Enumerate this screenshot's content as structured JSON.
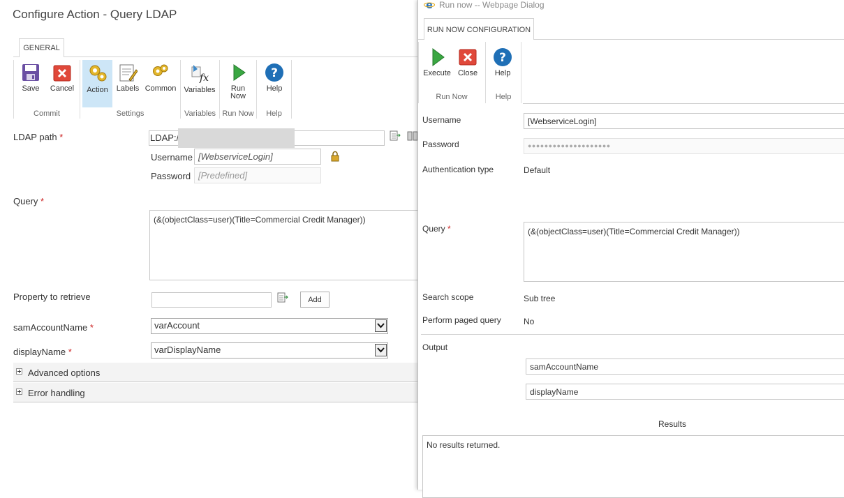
{
  "left": {
    "title": "Configure Action - Query LDAP",
    "tab": "GENERAL",
    "ribbon": {
      "save": "Save",
      "cancel": "Cancel",
      "action": "Action",
      "labels": "Labels",
      "common": "Common",
      "variables": "Variables",
      "run_now": "Run Now",
      "help": "Help",
      "groups": {
        "commit": "Commit",
        "settings": "Settings",
        "variables": "Variables",
        "run_now": "Run Now",
        "help": "Help"
      }
    },
    "ldap_path": {
      "label": "LDAP path",
      "value": "LDAP://"
    },
    "username": {
      "label": "Username",
      "value": "[WebserviceLogin]"
    },
    "password": {
      "label": "Password",
      "value": "[Predefined]"
    },
    "query": {
      "label": "Query",
      "value": "(&(objectClass=user)(Title=Commercial Credit Manager))"
    },
    "property": {
      "label": "Property to retrieve",
      "value": "",
      "add": "Add"
    },
    "sam": {
      "label": "samAccountName",
      "value": "varAccount"
    },
    "display": {
      "label": "displayName",
      "value": "varDisplayName"
    },
    "required_mark": "*",
    "advanced": "Advanced options",
    "error": "Error handling"
  },
  "dialog": {
    "title": "Run now -- Webpage Dialog",
    "tab": "RUN NOW CONFIGURATION",
    "ribbon": {
      "execute": "Execute",
      "close": "Close",
      "help": "Help",
      "groups": {
        "run_now": "Run Now",
        "help": "Help"
      }
    },
    "username": {
      "label": "Username",
      "value": "[WebserviceLogin]"
    },
    "password": {
      "label": "Password",
      "value": "●●●●●●●●●●●●●●●●●●●●"
    },
    "auth": {
      "label": "Authentication type",
      "value": "Default"
    },
    "query": {
      "label": "Query",
      "value": "(&(objectClass=user)(Title=Commercial Credit Manager))"
    },
    "scope": {
      "label": "Search scope",
      "value": "Sub tree"
    },
    "paged": {
      "label": "Perform paged query",
      "value": "No"
    },
    "output": {
      "label": "Output",
      "items": [
        "samAccountName",
        "displayName"
      ]
    },
    "results": {
      "label": "Results",
      "value": "No results returned."
    }
  },
  "colors": {
    "required": "#cc2222",
    "selected_button": "#cde6f7",
    "ie_icon": "#1e6fc2"
  }
}
